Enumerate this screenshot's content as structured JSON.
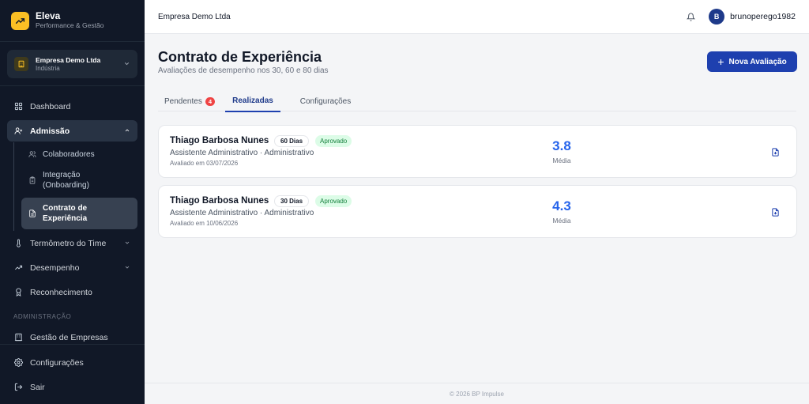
{
  "brand": {
    "name": "Eleva",
    "subtitle": "Performance & Gestão",
    "logo_icon": "trend-up-icon",
    "logo_color": "#fbbf24"
  },
  "company_selector": {
    "name": "Empresa Demo Ltda",
    "sector": "Indústria",
    "icon": "building-icon"
  },
  "sidebar": {
    "items": [
      {
        "label": "Dashboard",
        "icon": "grid-icon"
      },
      {
        "label": "Admissão",
        "icon": "user-plus-icon",
        "expanded": true
      },
      {
        "label": "Termômetro do Time",
        "icon": "thermometer-icon"
      },
      {
        "label": "Desempenho",
        "icon": "trend-icon"
      },
      {
        "label": "Reconhecimento",
        "icon": "award-icon"
      }
    ],
    "subitems": [
      {
        "label": "Colaboradores",
        "icon": "users-icon"
      },
      {
        "label": "Integração (Onboarding)",
        "icon": "clipboard-icon"
      },
      {
        "label": "Contrato de Experiência",
        "icon": "file-text-icon",
        "active": true
      }
    ],
    "section_admin": "ADMINISTRAÇÃO",
    "admin_items": [
      {
        "label": "Gestão de Empresas",
        "icon": "building-icon"
      }
    ],
    "bottom_items": [
      {
        "label": "Configurações",
        "icon": "gear-icon"
      },
      {
        "label": "Sair",
        "icon": "logout-icon"
      }
    ]
  },
  "topbar": {
    "company": "Empresa Demo Ltda",
    "avatar_initial": "B",
    "username": "brunoperego1982"
  },
  "page": {
    "title": "Contrato de Experiência",
    "subtitle": "Avaliações de desempenho nos 30, 60 e 80 dias",
    "new_button": "Nova Avaliação",
    "accent_color": "#1e40af"
  },
  "tabs": [
    {
      "label": "Pendentes",
      "badge": "4"
    },
    {
      "label": "Realizadas",
      "active": true
    },
    {
      "label": "Configurações"
    }
  ],
  "evaluations": [
    {
      "name": "Thiago Barbosa Nunes",
      "period": "60 Dias",
      "status": "Aprovado",
      "role": "Assistente Administrativo · Administrativo",
      "date": "Avaliado em 03/07/2026",
      "score": "3.8",
      "score_label": "Média"
    },
    {
      "name": "Thiago Barbosa Nunes",
      "period": "30 Dias",
      "status": "Aprovado",
      "role": "Assistente Administrativo · Administrativo",
      "date": "Avaliado em 10/06/2026",
      "score": "4.3",
      "score_label": "Média"
    }
  ],
  "footer": "© 2026 BP Impulse"
}
